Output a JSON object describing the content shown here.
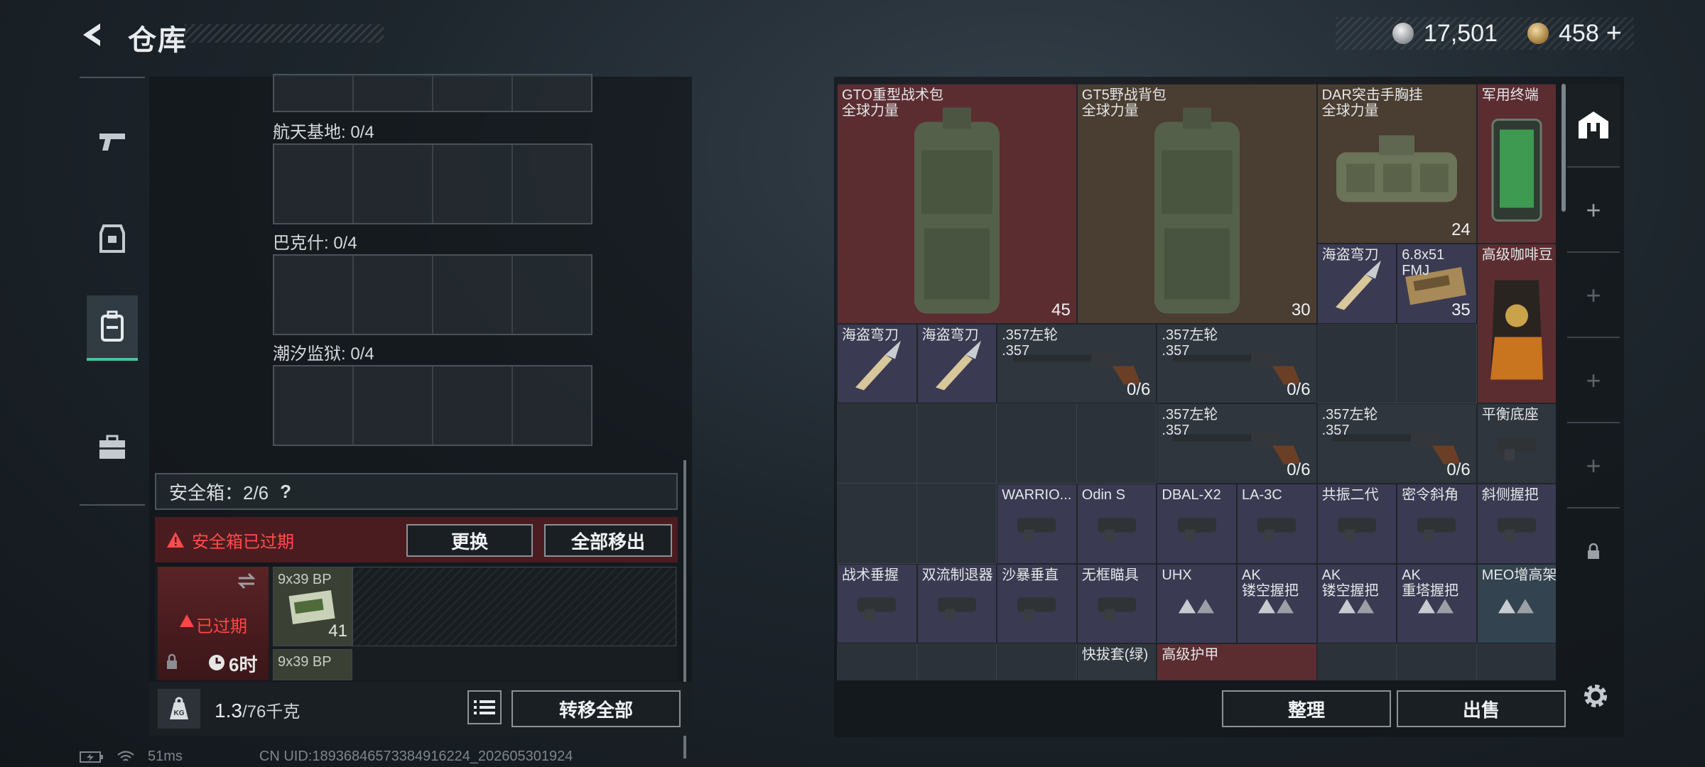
{
  "header": {
    "title": "仓库"
  },
  "currency": {
    "silver": "17,501",
    "gold": "458",
    "plus": "+"
  },
  "nav": [
    "weapons",
    "armor",
    "backpack",
    "toolbox"
  ],
  "left": {
    "maps": [
      {
        "label": "航天基地: 0/4"
      },
      {
        "label": "巴克什: 0/4"
      },
      {
        "label": "潮汐监狱: 0/4"
      }
    ],
    "safe_box": {
      "label": "安全箱：2/6",
      "help": "?"
    },
    "expired_warning": "安全箱已过期",
    "replace_label": "更换",
    "move_all_label": "全部移出",
    "expired_slot": {
      "label": "已过期",
      "timer": "6时"
    },
    "ammo": [
      {
        "name": "9x39\nBP",
        "count": "41"
      },
      {
        "name": "9x39\nBP",
        "count": ""
      }
    ],
    "weight_value": "1.3",
    "weight_max": "/76千克",
    "kg_label": "KG",
    "transfer_all_label": "转移全部"
  },
  "inventory": [
    {
      "name": "GTO重型战术包\n全球力量",
      "qty": "45",
      "color": "red",
      "art": "backpack"
    },
    {
      "name": "GT5野战背包\n全球力量",
      "qty": "30",
      "color": "brown",
      "art": "backpack"
    },
    {
      "name": "DAR突击手胸挂\n全球力量",
      "qty": "24",
      "color": "brown",
      "art": "vest"
    },
    {
      "name": "军用终端",
      "qty": "",
      "color": "red",
      "art": "terminal"
    },
    {
      "name": "海盗弯刀",
      "qty": "",
      "color": "purple",
      "art": "knife"
    },
    {
      "name": "6.8x51\nFMJ",
      "qty": "35",
      "color": "purple",
      "art": "ammo"
    },
    {
      "name": "高级咖啡豆",
      "qty": "",
      "color": "red",
      "art": "coffee"
    },
    {
      "name": "海盗弯刀",
      "qty": "",
      "color": "purple",
      "art": "knife"
    },
    {
      "name": "海盗弯刀",
      "qty": "",
      "color": "purple",
      "art": "knife"
    },
    {
      "name": ".357左轮\n.357",
      "qty": "0/6",
      "color": "gray",
      "art": "revolver"
    },
    {
      "name": ".357左轮\n.357",
      "qty": "0/6",
      "color": "gray",
      "art": "revolver"
    },
    {
      "name": ".357左轮\n.357",
      "qty": "0/6",
      "color": "gray",
      "art": "revolver"
    },
    {
      "name": ".357左轮\n.357",
      "qty": "0/6",
      "color": "gray",
      "art": "revolver"
    },
    {
      "name": "平衡底座",
      "qty": "",
      "color": "gray",
      "art": "part"
    },
    {
      "name": "WARRIO...",
      "qty": "",
      "color": "purple",
      "art": "part"
    },
    {
      "name": "Odin S",
      "qty": "",
      "color": "purple",
      "art": "part"
    },
    {
      "name": "DBAL-X2",
      "qty": "",
      "color": "purple",
      "art": "part"
    },
    {
      "name": "LA-3C",
      "qty": "",
      "color": "purple",
      "art": "part"
    },
    {
      "name": "共振二代",
      "qty": "",
      "color": "purple",
      "art": "part"
    },
    {
      "name": "密令斜角",
      "qty": "",
      "color": "purple",
      "art": "part"
    },
    {
      "name": "斜侧握把",
      "qty": "",
      "color": "purple",
      "art": "part"
    },
    {
      "name": "战术垂握",
      "qty": "",
      "color": "purple",
      "art": "part"
    },
    {
      "name": "双流制退器",
      "qty": "",
      "color": "purple",
      "art": "part"
    },
    {
      "name": "沙暴垂直",
      "qty": "",
      "color": "purple",
      "art": "part"
    },
    {
      "name": "无框瞄具",
      "qty": "",
      "color": "purple",
      "art": "part"
    },
    {
      "name": "UHX",
      "qty": "",
      "color": "purple",
      "art": "tri"
    },
    {
      "name": "AK\n镂空握把",
      "qty": "",
      "color": "purple",
      "art": "tri"
    },
    {
      "name": "AK\n镂空握把",
      "qty": "",
      "color": "purple",
      "art": "tri"
    },
    {
      "name": "AK\n重塔握把",
      "qty": "",
      "color": "purple",
      "art": "tri"
    },
    {
      "name": "MEO增高架",
      "qty": "",
      "color": "blue",
      "art": "tri"
    },
    {
      "name": "快拔套(绿)",
      "qty": "",
      "color": "gray",
      "art": ""
    },
    {
      "name": "高级护甲",
      "qty": "",
      "color": "red",
      "art": ""
    }
  ],
  "actions": {
    "sort_label": "整理",
    "sell_label": "出售"
  },
  "status": {
    "ping": "51ms",
    "uid": "CN UID:189368465733849162​24_202605301924"
  },
  "colors": {
    "accent": "#49c39a",
    "danger": "#ff4b4b"
  }
}
